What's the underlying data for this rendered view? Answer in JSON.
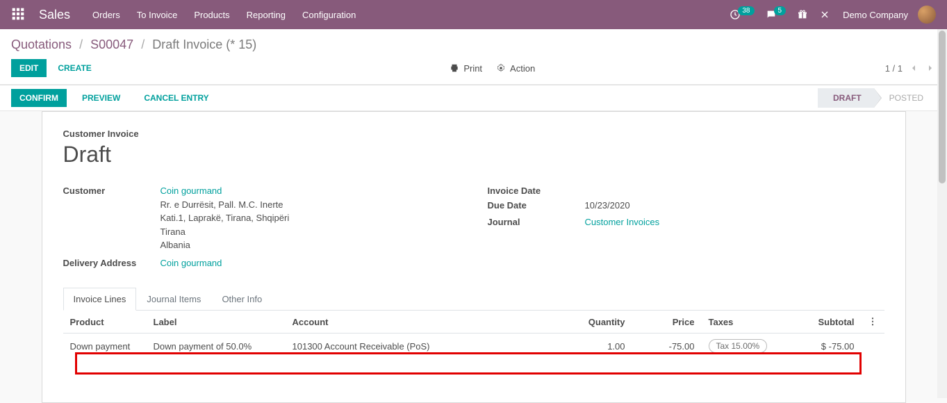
{
  "nav": {
    "brand": "Sales",
    "items": [
      "Orders",
      "To Invoice",
      "Products",
      "Reporting",
      "Configuration"
    ],
    "badge1": "38",
    "badge2": "5",
    "company": "Demo Company"
  },
  "breadcrumb": {
    "a": "Quotations",
    "b": "S00047",
    "c": "Draft Invoice (* 15)"
  },
  "buttons": {
    "edit": "Edit",
    "create": "Create",
    "print": "Print",
    "action": "Action",
    "confirm": "Confirm",
    "preview": "Preview",
    "cancel": "Cancel Entry"
  },
  "pager": "1 / 1",
  "status": {
    "draft": "Draft",
    "posted": "Posted"
  },
  "doc": {
    "type_label": "Customer Invoice",
    "title": "Draft",
    "customer_label": "Customer",
    "customer_name": "Coin gourmand",
    "addr1": "Rr. e Durrësit, Pall. M.C. Inerte",
    "addr2": "Kati.1, Laprakë, Tirana, Shqipëri",
    "addr3": "Tirana",
    "addr4": "Albania",
    "delivery_label": "Delivery Address",
    "delivery_value": "Coin gourmand",
    "invoice_date_label": "Invoice Date",
    "invoice_date_value": "",
    "due_date_label": "Due Date",
    "due_date_value": "10/23/2020",
    "journal_label": "Journal",
    "journal_value": "Customer Invoices"
  },
  "tabs": {
    "t1": "Invoice Lines",
    "t2": "Journal Items",
    "t3": "Other Info"
  },
  "table": {
    "h_product": "Product",
    "h_label": "Label",
    "h_account": "Account",
    "h_qty": "Quantity",
    "h_price": "Price",
    "h_taxes": "Taxes",
    "h_subtotal": "Subtotal",
    "row": {
      "product": "Down payment",
      "label": "Down payment of 50.0%",
      "account": "101300 Account Receivable (PoS)",
      "qty": "1.00",
      "price": "-75.00",
      "tax": "Tax 15.00%",
      "subtotal": "$ -75.00"
    }
  }
}
